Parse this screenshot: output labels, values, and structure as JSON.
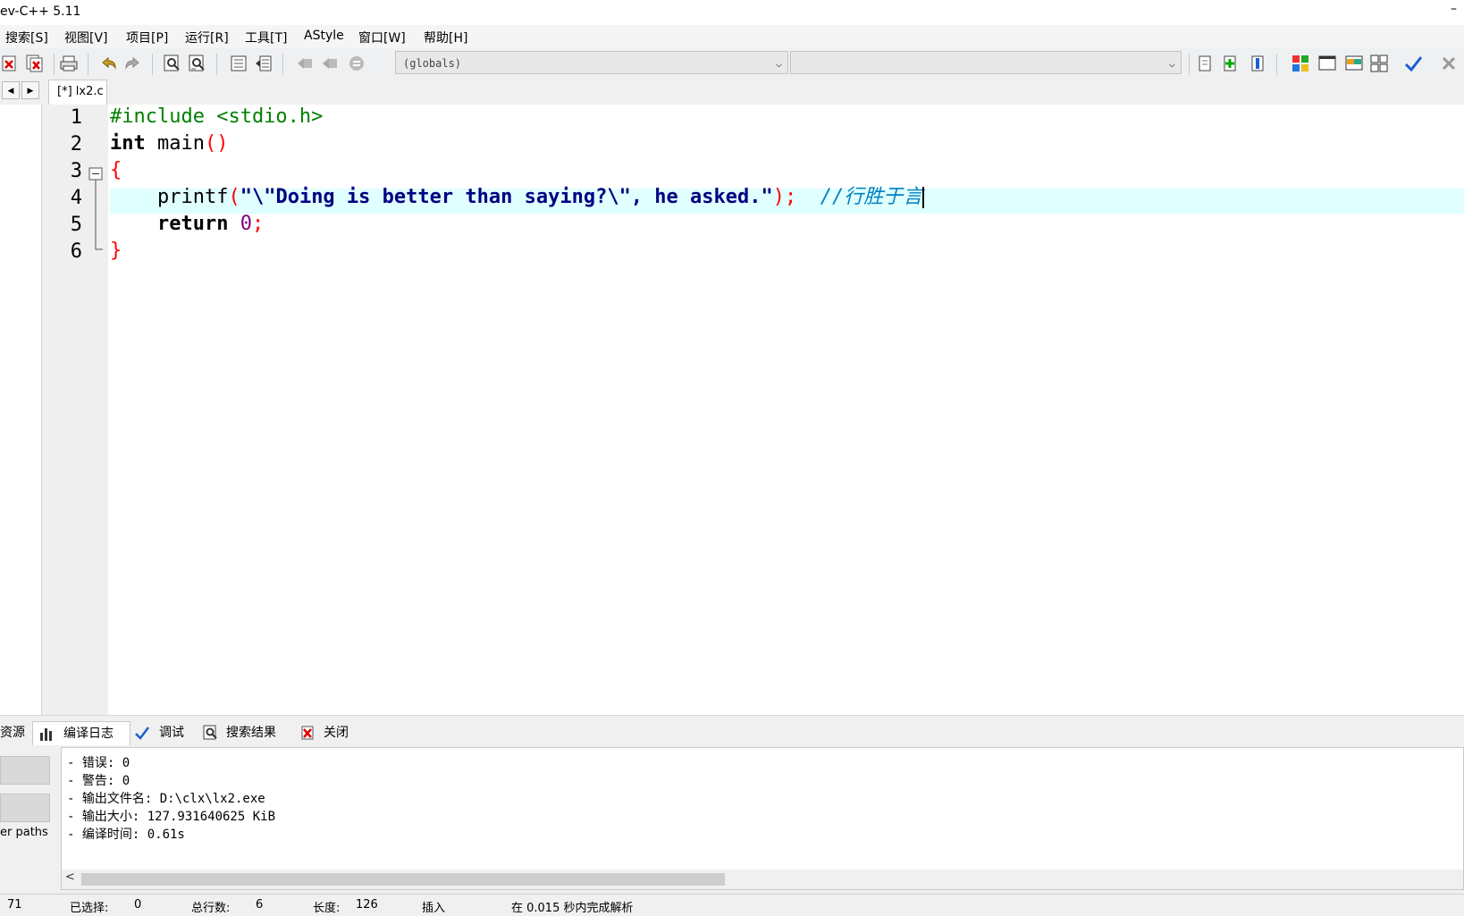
{
  "window": {
    "title": "ev-C++ 5.11",
    "minimize_glyph": "–"
  },
  "menu": [
    "搜索[S]",
    "视图[V]",
    "项目[P]",
    "运行[R]",
    "工具[T]",
    "AStyle",
    "窗口[W]",
    "帮助[H]"
  ],
  "toolbar": {
    "icons": [
      "close-file-icon",
      "close-all-icon",
      "print-icon",
      "undo-icon",
      "redo-icon",
      "find-icon",
      "replace-icon",
      "indent-icon",
      "unindent-icon",
      "back-icon",
      "forward-icon",
      "goto-icon",
      "project-new-icon",
      "project-add-icon",
      "project-remove-icon",
      "layout-grid-icon",
      "window-icon",
      "window-color-icon",
      "window-tile-icon",
      "check-icon",
      "cross-icon"
    ],
    "scope_combo": "(globals)",
    "member_combo": ""
  },
  "tabs": {
    "file_tab": "[*] lx2.c",
    "prev_glyph": "◀",
    "next_glyph": "▶"
  },
  "editor": {
    "line_numbers": [
      "1",
      "2",
      "3",
      "4",
      "5",
      "6"
    ],
    "current_line": 4,
    "line1": {
      "include": "#include <stdio.h>"
    },
    "line2": {
      "type": "int",
      "name": " main",
      "parens": "()"
    },
    "line3": {
      "brace": "{"
    },
    "line4": {
      "indent": "    ",
      "func": "printf",
      "open": "(",
      "string": "\"\\\"Doing is better than saying?\\\", he asked.\"",
      "close": ");",
      "gap": "  ",
      "comment": "//行胜于言"
    },
    "line5": {
      "indent": "    ",
      "keyword": "return",
      "space": " ",
      "number": "0",
      "semi": ";"
    },
    "line6": {
      "brace": "}"
    }
  },
  "bottom_tabs": [
    "资源",
    "编译日志",
    "调试",
    "搜索结果",
    "关闭"
  ],
  "compile_log": [
    "- 错误: 0",
    "- 警告: 0",
    "- 输出文件名: D:\\clx\\lx2.exe",
    "- 输出大小: 127.931640625 KiB",
    "- 编译时间: 0.61s"
  ],
  "left_panel": {
    "paths_label": "er paths"
  },
  "status": {
    "col": "71",
    "selected_label": "已选择:",
    "selected_value": "0",
    "lines_label": "总行数:",
    "lines_value": "6",
    "length_label": "长度:",
    "length_value": "126",
    "mode": "插入",
    "parse": "在 0.015 秒内完成解析"
  },
  "colors": {
    "accent": "#0080c0",
    "current_line": "#e0ffff",
    "string": "#000080",
    "preprocessor": "#008000",
    "symbol": "#ff0000"
  }
}
